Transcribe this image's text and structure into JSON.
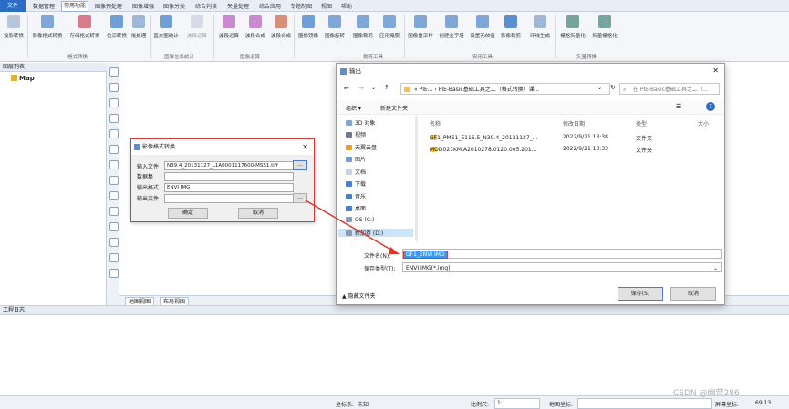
{
  "menubar": {
    "file": "文件",
    "items": [
      "数据管理",
      "常用功能",
      "图像预处理",
      "图像增强",
      "图像分类",
      "综合判读",
      "矢量处理",
      "综合应用",
      "专题制图",
      "视图",
      "帮助"
    ],
    "active_index": 1
  },
  "ribbon": {
    "buttons": [
      "投影转换",
      "影像格式转换",
      "存储格式转换",
      "位深转换",
      "批处理",
      "直方图统计",
      "波段运算",
      "波段运算",
      "波段合成",
      "图像镜像",
      "图像旋转",
      "图像裁剪",
      "应用掩膜",
      "图像重采样",
      "创建金字塔",
      "设置无效值",
      "影像裁剪",
      "环线生成",
      "栅格矢量化",
      "矢量栅格化"
    ],
    "groups": [
      "格式转换",
      "图像信息统计",
      "图像运算",
      "裁剪工具",
      "实用工具",
      "矢量转换"
    ]
  },
  "layer_panel": {
    "title": "图层列表",
    "root": "Map"
  },
  "map_tabs": [
    "地图视图",
    "布局视图"
  ],
  "log_panel": {
    "title": "工程日志"
  },
  "status": {
    "coord_sys_label": "坐标系:",
    "coord_sys_value": "未知",
    "scale_label": "比例尺:",
    "scale_value": "1:",
    "map_coord_label": "地图坐标:",
    "screen_coord_label": "屏幕坐标:",
    "screen_coord_value": "69 13"
  },
  "format_dialog": {
    "title": "影像格式转换",
    "input_label": "输入文件",
    "input_value": "N39.4_20131127_L1A0001117600-MSS1.tiff",
    "dataset_label": "数据集",
    "output_format_label": "输出格式",
    "output_format_value": "ENVI IMG",
    "output_file_label": "输出文件",
    "output_file_value": "",
    "browse": "...",
    "ok": "确定",
    "cancel": "取消"
  },
  "output_dialog": {
    "title": "输出",
    "address": "« PIE... › PIE-Basic基础工具之二（格式转换）课...",
    "search_placeholder": "在 PIE-Basic基础工具之二（...",
    "organize": "组织 ▾",
    "new_folder": "新建文件夹",
    "tree": [
      "3D 对象",
      "视频",
      "天翼云盘",
      "图片",
      "文档",
      "下载",
      "音乐",
      "桌面",
      "OS (C:)",
      "新加卷 (D:)"
    ],
    "columns": [
      "名称",
      "修改日期",
      "类型",
      "大小"
    ],
    "files": [
      {
        "name": "GF1_PMS1_E116.5_N39.4_20131127_...",
        "date": "2022/9/21 13:38",
        "type": "文件夹"
      },
      {
        "name": "MOD021KM.A2010278.0120.005.201...",
        "date": "2022/9/21 13:33",
        "type": "文件夹"
      }
    ],
    "filename_label": "文件名(N):",
    "filename_value": "GF1_ENVI IMG",
    "filetype_label": "保存类型(T):",
    "filetype_value": "ENVI IMG(*.img)",
    "hide_folders": "隐藏文件夹",
    "save": "保存(S)",
    "cancel": "取消"
  },
  "watermark": "CSDN @幽荧286",
  "colors": {
    "accent": "#2b6cc4",
    "highlight": "#3399ff",
    "arrow": "#e0302a"
  }
}
